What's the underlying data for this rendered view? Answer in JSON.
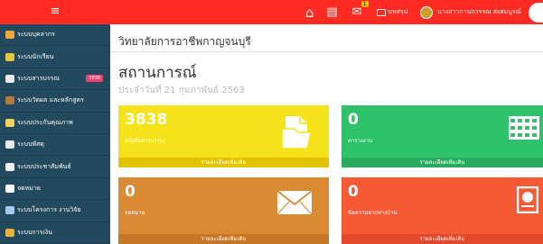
{
  "topbar": {
    "menu_glyph": "≡",
    "home_glyph": "⌂",
    "news_glyph": "▤",
    "notify_glyph": "✉",
    "notify_badge": "1",
    "module_label": "บทสรุป",
    "username": "นางสาวกานกวรรณ ส่งสมบูรณ์"
  },
  "sidebar": {
    "items": [
      {
        "label": "ระบบบุคลากร",
        "icon_color": "#f2a63a"
      },
      {
        "label": "ระบบนักเรียน",
        "icon_color": "#e8c53a"
      },
      {
        "label": "ระบบสารบรรณ",
        "icon_color": "#e9e9e9",
        "badge": "3838"
      },
      {
        "label": "ระบบวัดผล และหลักสูตร",
        "icon_color": "#b57a3a"
      },
      {
        "label": "ระบบประกันคุณภาพ",
        "icon_color": "#f3d35a"
      },
      {
        "label": "ระบบพัสดุ",
        "icon_color": "#e9e9e9"
      },
      {
        "label": "ระบบประชาสัมพันธ์",
        "icon_color": "#f2f2f2"
      },
      {
        "label": "จดหมาย",
        "icon_color": "#ffffff"
      },
      {
        "label": "ระบบโครงการ งานวิจัย",
        "icon_color": "#a8c8ee"
      },
      {
        "label": "ระบบการเงิน",
        "icon_color": "#e6b43a"
      }
    ]
  },
  "main": {
    "college": "วิทยาลัยการอาชีพกาญจนบุรี",
    "title": "สถานการณ์",
    "date": "ประจำวันที่ 21 กุมภาพันธ์ 2563"
  },
  "cards": [
    {
      "value": "3838",
      "label": "หนังสือสารบรรณ",
      "footer": "รายละเอียดเพิ่มเติม"
    },
    {
      "value": "0",
      "label": "ตารางงาน",
      "footer": "รายละเอียดเพิ่มเติม"
    },
    {
      "value": "0",
      "label": "จดหมาย",
      "footer": "รายละเอียดเพิ่มเติม"
    },
    {
      "value": "0",
      "label": "ข้อความจากทางบ้าน",
      "footer": "รายละเอียดเพิ่มเติม"
    }
  ],
  "colors": {
    "topbar": "#ff2b22",
    "sidebar": "#23495e",
    "card_yellow": "#f6e21b",
    "card_green": "#2ec26a",
    "card_orange": "#d98a33",
    "card_red": "#f55a35"
  }
}
